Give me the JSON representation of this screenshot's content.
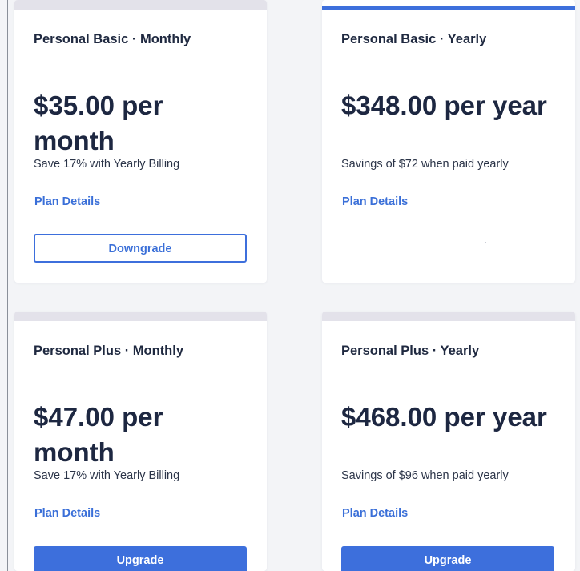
{
  "plans": [
    {
      "title": "Personal Basic · Monthly",
      "price": "$35.00 per month",
      "note": "Save 17% with Yearly Billing",
      "details_label": "Plan Details",
      "action_label": "Downgrade"
    },
    {
      "title": "Personal Basic · Yearly",
      "price": "$348.00 per year",
      "note": "Savings of $72 when paid yearly",
      "details_label": "Plan Details",
      "current": true
    },
    {
      "title": "Personal Plus · Monthly",
      "price": "$47.00 per month",
      "note": "Save 17% with Yearly Billing",
      "details_label": "Plan Details",
      "action_label": "Upgrade"
    },
    {
      "title": "Personal Plus · Yearly",
      "price": "$468.00 per year",
      "note": "Savings of $96 when paid yearly",
      "details_label": "Plan Details",
      "action_label": "Upgrade"
    }
  ],
  "colors": {
    "accent": "#3d6fdc",
    "text_dark": "#1d2741",
    "inactive_bar": "#e3e2ea",
    "page_bg": "#f3f4f7"
  }
}
